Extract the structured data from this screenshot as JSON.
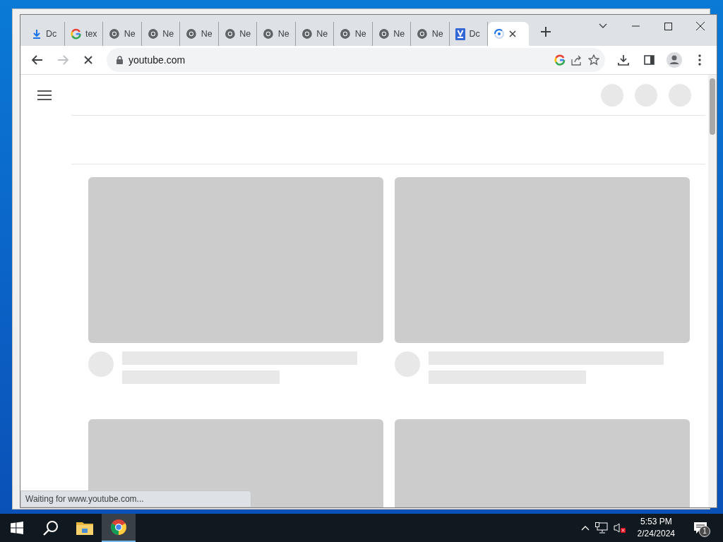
{
  "browser": {
    "tabs": [
      {
        "kind": "download",
        "label": "Dc",
        "selected": false
      },
      {
        "kind": "google",
        "label": "tex",
        "selected": false
      },
      {
        "kind": "chrome",
        "label": "Ne",
        "selected": false
      },
      {
        "kind": "chrome",
        "label": "Ne",
        "selected": false
      },
      {
        "kind": "chrome",
        "label": "Ne",
        "selected": false
      },
      {
        "kind": "chrome",
        "label": "Ne",
        "selected": false
      },
      {
        "kind": "chrome",
        "label": "Ne",
        "selected": false
      },
      {
        "kind": "chrome",
        "label": "Ne",
        "selected": false
      },
      {
        "kind": "chrome",
        "label": "Ne",
        "selected": false
      },
      {
        "kind": "chrome",
        "label": "Ne",
        "selected": false
      },
      {
        "kind": "chrome",
        "label": "Ne",
        "selected": false
      },
      {
        "kind": "docs",
        "label": "Dc",
        "selected": false
      },
      {
        "kind": "loading",
        "selected": true
      }
    ],
    "address": "youtube.com",
    "loading": true,
    "status_text": "Waiting for www.youtube.com..."
  },
  "taskbar": {
    "apps": [
      {
        "kind": "explorer",
        "active": false
      },
      {
        "kind": "chrome",
        "active": true
      }
    ],
    "time": "5:53 PM",
    "date": "2/24/2024",
    "notification_count": "1"
  }
}
